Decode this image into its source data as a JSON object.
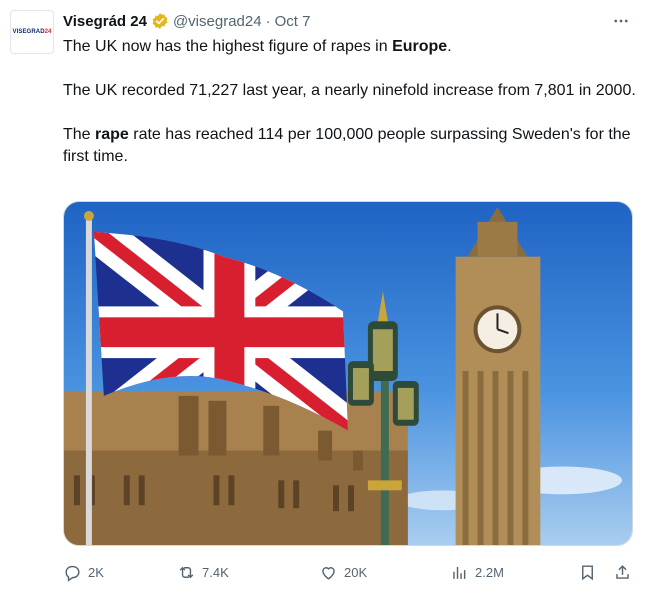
{
  "avatar": {
    "logo_main": "VISEGRAD",
    "logo_accent": "24",
    "icon": "visegrad24-logo"
  },
  "header": {
    "display_name": "Visegrád 24",
    "verified_icon": "verified-badge-icon",
    "handle": "@visegrad24",
    "separator": "·",
    "time": "Oct 7",
    "more_icon": "more-horizontal-icon"
  },
  "tweet": {
    "line1_text": "The UK now has the highest figure of rapes in ",
    "line1_bold": "Europe",
    "line1_end": ".",
    "para2": "The UK recorded 71,227 last year, a nearly ninefold increase from 7,801 in 2000.",
    "para3_start": "The ",
    "para3_bold": "rape",
    "para3_end": " rate has reached 114 per 100,000 people surpassing Sweden's for the first time."
  },
  "media": {
    "description_icon": "photo-union-jack-big-ben"
  },
  "actions": {
    "reply": {
      "icon": "reply-icon",
      "count": "2K"
    },
    "repost": {
      "icon": "repost-icon",
      "count": "7.4K"
    },
    "like": {
      "icon": "like-icon",
      "count": "20K"
    },
    "views": {
      "icon": "views-icon",
      "count": "2.2M"
    },
    "bookmark": {
      "icon": "bookmark-icon"
    },
    "share": {
      "icon": "share-icon"
    }
  },
  "colors": {
    "text": "#0f1419",
    "secondary": "#536471",
    "verified_gold": "#e2b719",
    "border": "#cfd9de"
  }
}
